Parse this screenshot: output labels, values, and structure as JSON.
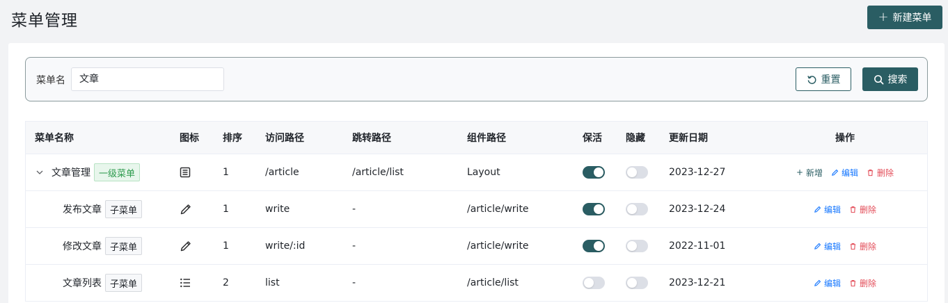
{
  "header": {
    "title": "菜单管理",
    "new_button": "新建菜单"
  },
  "search": {
    "label": "菜单名",
    "value": "文章",
    "reset_label": "重置",
    "search_label": "搜索"
  },
  "table": {
    "columns": [
      "菜单名称",
      "图标",
      "排序",
      "访问路径",
      "跳转路径",
      "组件路径",
      "保活",
      "隐藏",
      "更新日期",
      "操作"
    ],
    "rows": [
      {
        "name": "文章管理",
        "tag": "一级菜单",
        "icon": "document-icon",
        "sort": "1",
        "path": "/article",
        "redirect": "/article/list",
        "component": "Layout",
        "keep_alive": true,
        "hidden": false,
        "date": "2023-12-27"
      },
      {
        "name": "发布文章",
        "tag": "子菜单",
        "icon": "pencil-icon",
        "sort": "1",
        "path": "write",
        "redirect": "-",
        "component": "/article/write",
        "keep_alive": true,
        "hidden": false,
        "date": "2023-12-24"
      },
      {
        "name": "修改文章",
        "tag": "子菜单",
        "icon": "pencil-icon",
        "sort": "1",
        "path": "write/:id",
        "redirect": "-",
        "component": "/article/write",
        "keep_alive": true,
        "hidden": false,
        "date": "2022-11-01"
      },
      {
        "name": "文章列表",
        "tag": "子菜单",
        "icon": "list-icon",
        "sort": "2",
        "path": "list",
        "redirect": "-",
        "component": "/article/list",
        "keep_alive": false,
        "hidden": false,
        "date": "2023-12-21"
      }
    ],
    "ops": {
      "add": "新增",
      "edit": "编辑",
      "delete": "删除"
    }
  },
  "colors": {
    "primary": "#2a5d63",
    "edit": "#1677ff",
    "delete": "#e34d59",
    "tag_green": "#2e9b4e"
  }
}
